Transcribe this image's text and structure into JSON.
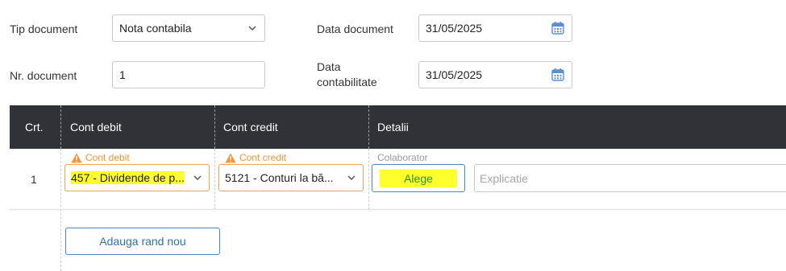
{
  "form": {
    "tip_document_label": "Tip document",
    "tip_document_value": "Nota contabila",
    "data_document_label": "Data document",
    "data_document_value": "31/05/2025",
    "nr_document_label": "Nr. document",
    "nr_document_value": "1",
    "data_contabilitate_label_line1": "Data",
    "data_contabilitate_label_line2": "contabilitate",
    "data_contabilitate_value": "31/05/2025"
  },
  "table": {
    "headers": [
      "Crt.",
      "Cont debit",
      "Cont credit",
      "Detalii"
    ],
    "rows": [
      {
        "crt": "1",
        "debit_hint": "Cont debit",
        "debit_value": "457 - Dividende de p...",
        "credit_hint": "Cont credit",
        "credit_value": "5121 - Conturi la bă...",
        "colaborator_label": "Colaborator",
        "alege_label": "Alege",
        "explicatie_placeholder": "Explicatie"
      }
    ]
  },
  "add_row_label": "Adauga rand nou",
  "colors": {
    "header_bg": "#303237",
    "warning": "#f0953a",
    "highlight": "#ffff2d",
    "button_border": "#4a86c8"
  },
  "icons": [
    "chevron-down-icon",
    "calendar-icon",
    "warning-icon"
  ]
}
